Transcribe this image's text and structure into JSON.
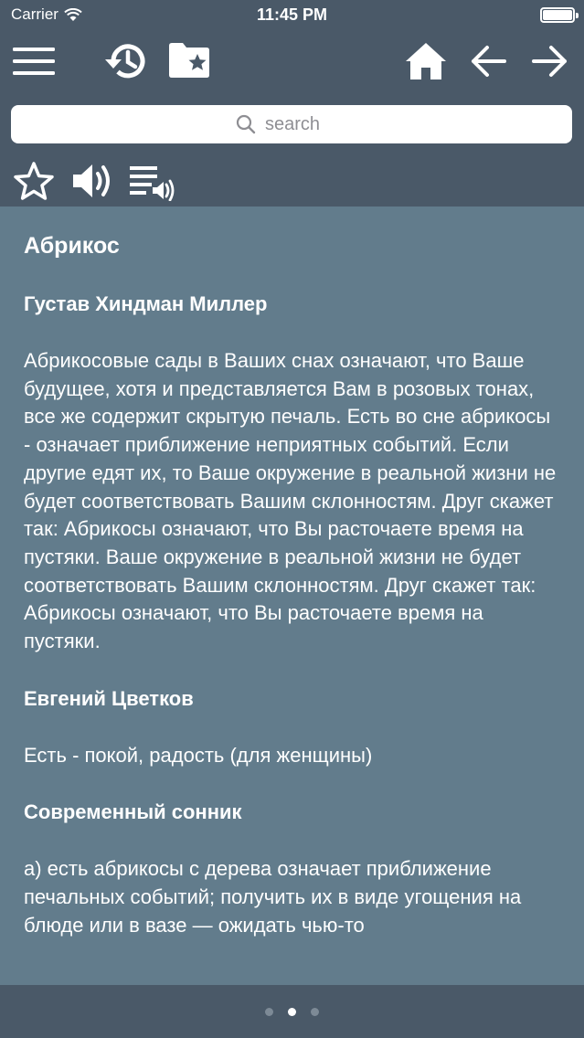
{
  "status_bar": {
    "carrier": "Carrier",
    "time": "11:45 PM",
    "battery_level": 1.0
  },
  "toolbar": {
    "icons": [
      "menu-icon",
      "history-icon",
      "bookmark-folder-icon",
      "home-icon",
      "back-arrow-icon",
      "forward-arrow-icon"
    ]
  },
  "search": {
    "placeholder": "search",
    "value": ""
  },
  "actions": {
    "icons": [
      "star-icon",
      "speaker-icon",
      "playlist-audio-icon"
    ]
  },
  "article": {
    "title": "Абрикос",
    "sections": [
      {
        "author": "Густав Хиндман Миллер",
        "text": "Абрикосовые сады в Ваших снах означают, что Ваше будущее, хотя и представляется Вам в розовых тонах, все же содержит скрытую печаль. Есть во сне абрикосы - означает приближение неприятных событий. Если другие едят их, то Ваше окружение в реальной жизни не будет соответствовать Вашим склонностям. Друг скажет так: Абрикосы означают, что Вы расточаете время на пустяки. Ваше окружение в реальной жизни не будет соответствовать Вашим склонностям. Друг скажет так: Абрикосы означают, что Вы расточаете время на пустяки."
      },
      {
        "author": "Евгений Цветков",
        "text": "Есть - покой, радость (для женщины)"
      },
      {
        "author": "Современный сонник",
        "text": "а) есть абрикосы с дерева означает приближение печальных событий; получить их в виде угощения на блюде или в вазе — ожидать чью-то"
      }
    ]
  },
  "pager": {
    "pages": 3,
    "current": 2
  },
  "colors": {
    "header_bg": "#4a5968",
    "content_bg": "#627c8c"
  }
}
